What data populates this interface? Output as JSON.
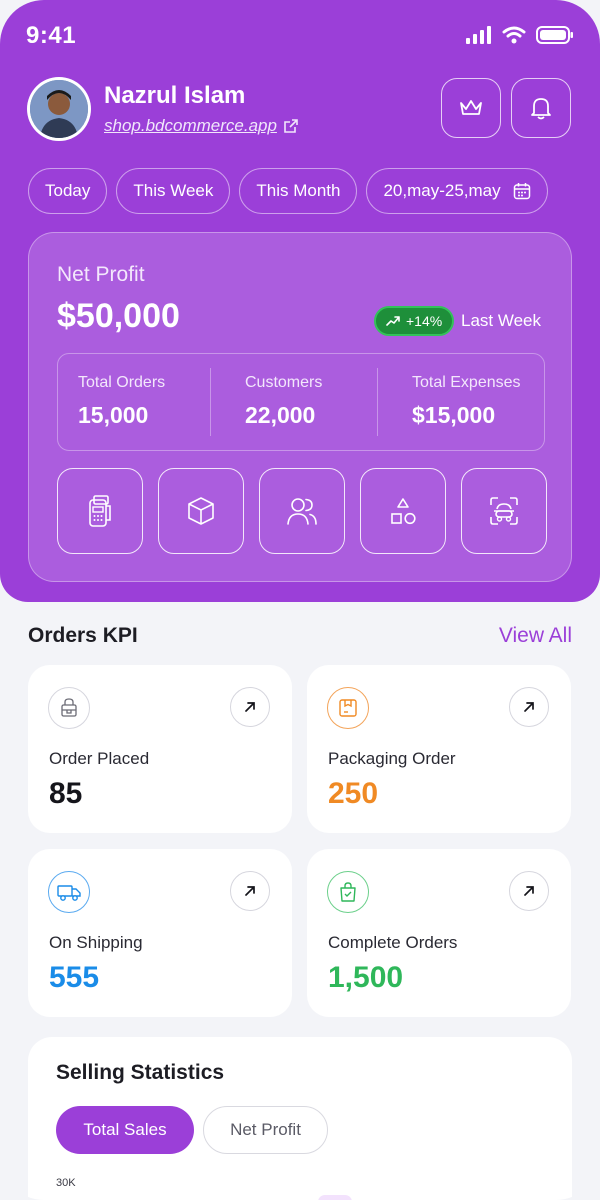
{
  "status_bar": {
    "time": "9:41"
  },
  "profile": {
    "name": "Nazrul Islam",
    "link": "shop.bdcommerce.app"
  },
  "header_actions": {
    "premium_icon": "crown-icon",
    "notifications_icon": "bell-icon"
  },
  "filters": [
    {
      "label": "Today"
    },
    {
      "label": "This Week"
    },
    {
      "label": "This Month"
    },
    {
      "label": "20,may-25,may",
      "icon": "calendar-icon"
    }
  ],
  "net_profit": {
    "label": "Net Profit",
    "value": "$50,000",
    "trend": "+14%",
    "trend_period": "Last Week",
    "trend_color": "#1e8f3a"
  },
  "summary_stats": [
    {
      "label": "Total Orders",
      "value": "15,000"
    },
    {
      "label": "Customers",
      "value": "22,000"
    },
    {
      "label": "Total Expenses",
      "value": "$15,000"
    }
  ],
  "quick_actions": [
    "pos-terminal-icon",
    "box-icon",
    "users-icon",
    "shapes-icon",
    "scan-icon"
  ],
  "orders_kpi": {
    "title": "Orders KPI",
    "view_all": "View All",
    "cards": [
      {
        "label": "Order Placed",
        "value": "85",
        "color": "#15151b",
        "icon": "order-icon"
      },
      {
        "label": "Packaging Order",
        "value": "250",
        "color": "#f08a24",
        "icon": "package-icon"
      },
      {
        "label": "On Shipping",
        "value": "555",
        "color": "#1a8ce8",
        "icon": "truck-icon"
      },
      {
        "label": "Complete Orders",
        "value": "1,500",
        "color": "#2fb75a",
        "icon": "shopping-bag-icon"
      }
    ]
  },
  "selling_statistics": {
    "title": "Selling Statistics",
    "tabs": [
      {
        "label": "Total Sales",
        "active": true
      },
      {
        "label": "Net Profit",
        "active": false
      }
    ],
    "y_tick_top": "30K"
  },
  "colors": {
    "brand": "#9b3fd8",
    "background": "#f3f4f8"
  }
}
